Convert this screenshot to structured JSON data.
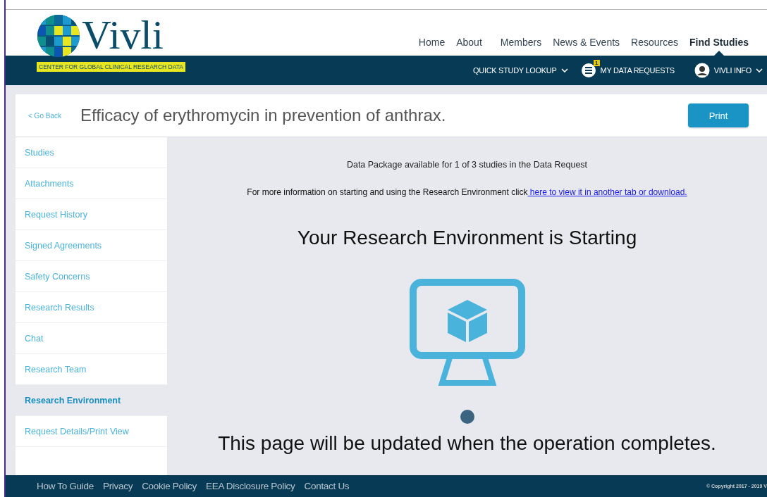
{
  "header": {
    "logo": {
      "wordmark": "Vivli",
      "tagline": "CENTER FOR GLOBAL CLINICAL RESEARCH DATA"
    },
    "nav": [
      {
        "label": "Home",
        "selected": false
      },
      {
        "label": "About",
        "selected": false
      },
      {
        "label": "Members",
        "selected": false
      },
      {
        "label": "News & Events",
        "selected": false
      },
      {
        "label": "Resources",
        "selected": false
      },
      {
        "label": "Find Studies",
        "selected": true
      }
    ],
    "toolbar": {
      "lookup": "QUICK STUDY LOOKUP",
      "requests": "MY DATA REQUESTS",
      "requests_badge": "1",
      "user": "VIVLI INFO"
    }
  },
  "page": {
    "back": "< Go Back",
    "title": "Efficacy of erythromycin in prevention of anthrax.",
    "print": "Print"
  },
  "sidebar": [
    {
      "label": "Studies",
      "selected": false
    },
    {
      "label": "Attachments",
      "selected": false
    },
    {
      "label": "Request History",
      "selected": false
    },
    {
      "label": "Signed Agreements",
      "selected": false
    },
    {
      "label": "Safety Concerns",
      "selected": false
    },
    {
      "label": "Research Results",
      "selected": false
    },
    {
      "label": "Chat",
      "selected": false
    },
    {
      "label": "Research Team",
      "selected": false
    },
    {
      "label": "Research Environment",
      "selected": true
    },
    {
      "label": "Request Details/Print View",
      "selected": false
    }
  ],
  "content": {
    "availability": "Data Package available for 1 of 3 studies in the Data Request",
    "info_text": "For more information on starting and using the Research Environment click",
    "info_link": " here to view it in another tab or download.",
    "heading": "Your Research Environment is Starting",
    "status": "This page will be updated when the operation completes."
  },
  "footer": {
    "links": [
      "How To Guide",
      "Privacy",
      "Cookie Policy",
      "EEA Disclosure Policy",
      "Contact Us"
    ],
    "copyright": "© Copyright 2017 - 2019 V"
  }
}
